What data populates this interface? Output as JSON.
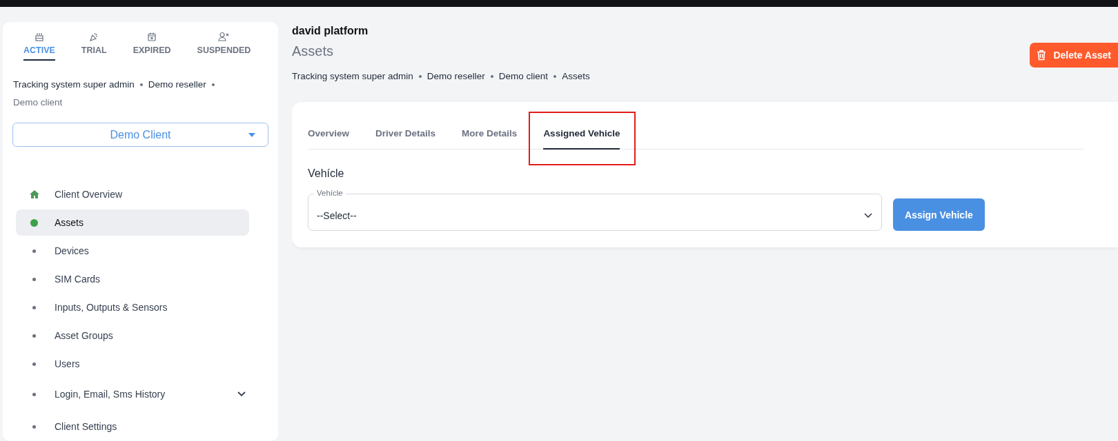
{
  "sidebar": {
    "status_tabs": [
      {
        "label": "ACTIVE",
        "kind": "cake",
        "selected": true
      },
      {
        "label": "TRIAL",
        "kind": "party",
        "selected": false
      },
      {
        "label": "EXPIRED",
        "kind": "calendar",
        "selected": false
      },
      {
        "label": "SUSPENDED",
        "kind": "user",
        "selected": false
      }
    ],
    "breadcrumb": [
      {
        "label": "Tracking system super admin",
        "current": false
      },
      {
        "label": "Demo reseller",
        "current": false
      },
      {
        "label": "Demo client",
        "current": true
      }
    ],
    "client_select": {
      "value": "Demo Client"
    },
    "menu": [
      {
        "label": "Client Overview",
        "kind": "home",
        "selected": false,
        "has_submenu": false
      },
      {
        "label": "Assets",
        "kind": "bullet",
        "selected": true,
        "has_submenu": false
      },
      {
        "label": "Devices",
        "kind": "bullet",
        "selected": false,
        "has_submenu": false
      },
      {
        "label": "SIM Cards",
        "kind": "bullet",
        "selected": false,
        "has_submenu": false
      },
      {
        "label": "Inputs, Outputs & Sensors",
        "kind": "bullet",
        "selected": false,
        "has_submenu": false
      },
      {
        "label": "Asset Groups",
        "kind": "bullet",
        "selected": false,
        "has_submenu": false
      },
      {
        "label": "Users",
        "kind": "bullet",
        "selected": false,
        "has_submenu": false
      },
      {
        "label": "Login, Email, Sms History",
        "kind": "bullet",
        "selected": false,
        "has_submenu": true
      },
      {
        "label": "Client Settings",
        "kind": "bullet",
        "selected": false,
        "has_submenu": false
      }
    ]
  },
  "header": {
    "platform": "david platform",
    "title": "Assets",
    "delete_button": "Delete Asset",
    "breadcrumb": [
      {
        "label": "Tracking system super admin",
        "current": false
      },
      {
        "label": "Demo reseller",
        "current": false
      },
      {
        "label": "Demo client",
        "current": false
      },
      {
        "label": "Assets",
        "current": false
      }
    ]
  },
  "tabs": [
    {
      "label": "Overview",
      "selected": false,
      "highlighted": false
    },
    {
      "label": "Driver Details",
      "selected": false,
      "highlighted": false
    },
    {
      "label": "More Details",
      "selected": false,
      "highlighted": false
    },
    {
      "label": "Assigned Vehicle",
      "selected": true,
      "highlighted": true
    }
  ],
  "section_title": "Vehícle",
  "vehicle_field": {
    "label": "Vehícle",
    "value": "--Select--"
  },
  "assign_button": "Assign Vehicle"
}
